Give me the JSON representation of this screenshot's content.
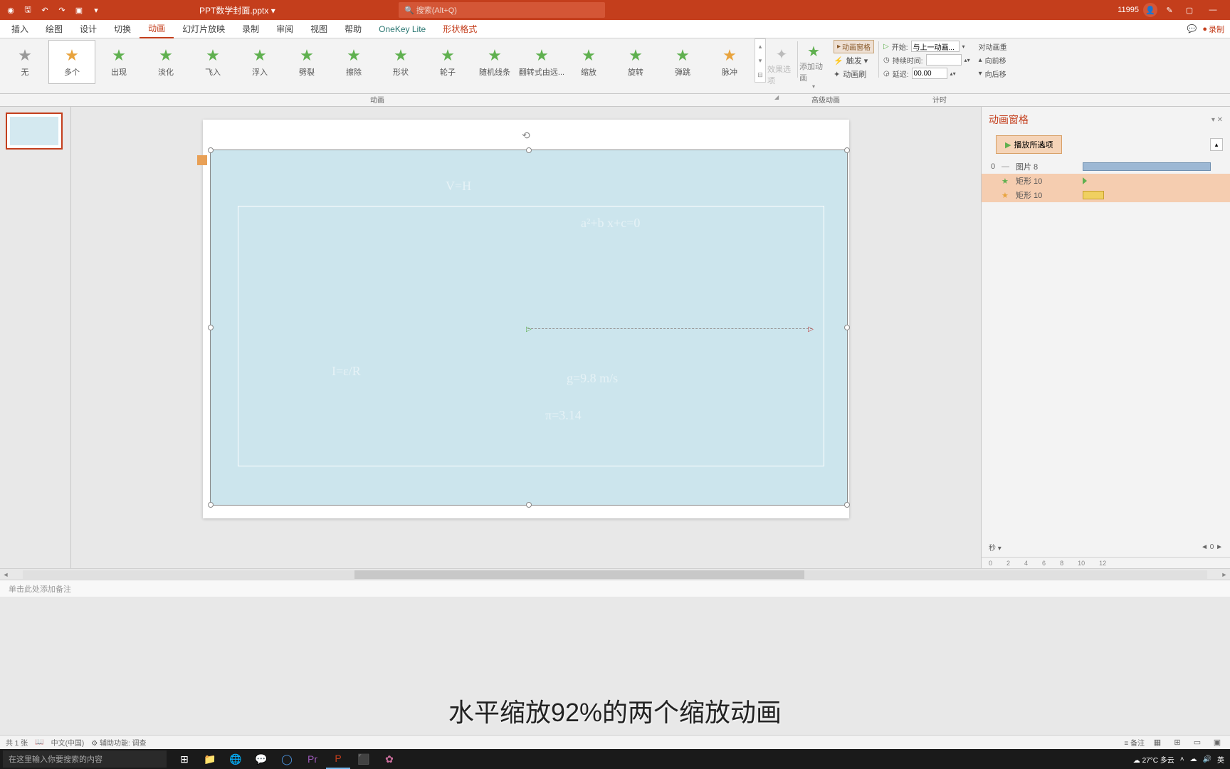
{
  "title_bar": {
    "file_name": "PPT数学封面.pptx ▾",
    "search_placeholder": "搜索(Alt+Q)",
    "user_points": "11995"
  },
  "tabs": {
    "insert": "插入",
    "draw": "绘图",
    "design": "设计",
    "transitions": "切换",
    "animations": "动画",
    "slideshow": "幻灯片放映",
    "record": "录制",
    "review": "审阅",
    "view": "视图",
    "help": "帮助",
    "onekey": "OneKey Lite",
    "shape_format": "形状格式",
    "rec_button": "录制"
  },
  "anim_gallery": [
    {
      "label": "无",
      "color": "gray"
    },
    {
      "label": "多个",
      "color": "yellow",
      "selected": true
    },
    {
      "label": "出现",
      "color": "green"
    },
    {
      "label": "淡化",
      "color": "green"
    },
    {
      "label": "飞入",
      "color": "green"
    },
    {
      "label": "浮入",
      "color": "green"
    },
    {
      "label": "劈裂",
      "color": "green"
    },
    {
      "label": "擦除",
      "color": "green"
    },
    {
      "label": "形状",
      "color": "green"
    },
    {
      "label": "轮子",
      "color": "green"
    },
    {
      "label": "随机线条",
      "color": "green"
    },
    {
      "label": "翻转式由远...",
      "color": "green"
    },
    {
      "label": "缩放",
      "color": "green"
    },
    {
      "label": "旋转",
      "color": "green"
    },
    {
      "label": "弹跳",
      "color": "green"
    },
    {
      "label": "脉冲",
      "color": "yellow"
    }
  ],
  "ribbon": {
    "group_animation": "动画",
    "effect_options": "效果选项",
    "add_animation": "添加动画",
    "animation_pane": "动画窗格",
    "trigger": "触发 ▾",
    "animation_painter": "动画刷",
    "group_advanced": "高级动画",
    "start_label": "开始:",
    "start_value": "与上一动画...",
    "duration_label": "持续时间:",
    "duration_value": "",
    "delay_label": "延迟:",
    "delay_value": "00.00",
    "reorder": "对动画重",
    "move_earlier": "向前移",
    "move_later": "向后移",
    "group_timing": "计时"
  },
  "anim_pane": {
    "title": "动画窗格",
    "play_button": "播放所选项",
    "items": [
      {
        "seq": "0",
        "icon": "—",
        "name": "图片 8",
        "bar_type": "blue"
      },
      {
        "seq": "",
        "icon": "★",
        "icon_color": "#5fb04f",
        "name": "矩形 10",
        "bar_type": "green-tri",
        "selected": true
      },
      {
        "seq": "",
        "icon": "★",
        "icon_color": "#e8a33d",
        "name": "矩形 10",
        "bar_type": "yellow",
        "selected": true
      }
    ],
    "seconds_label": "秒 ▾",
    "ruler": [
      "0",
      "2",
      "4",
      "6",
      "8",
      "10",
      "12"
    ]
  },
  "notes": {
    "placeholder": "单击此处添加备注"
  },
  "subtitle": "水平缩放92%的两个缩放动画",
  "status_bar": {
    "slide_info": "共 1 张",
    "language": "中文(中国)",
    "accessibility": "辅助功能: 调查",
    "notes_btn": "备注"
  },
  "taskbar": {
    "search_placeholder": "在这里输入你要搜索的内容",
    "weather": "27°C 多云",
    "ime": "英"
  }
}
